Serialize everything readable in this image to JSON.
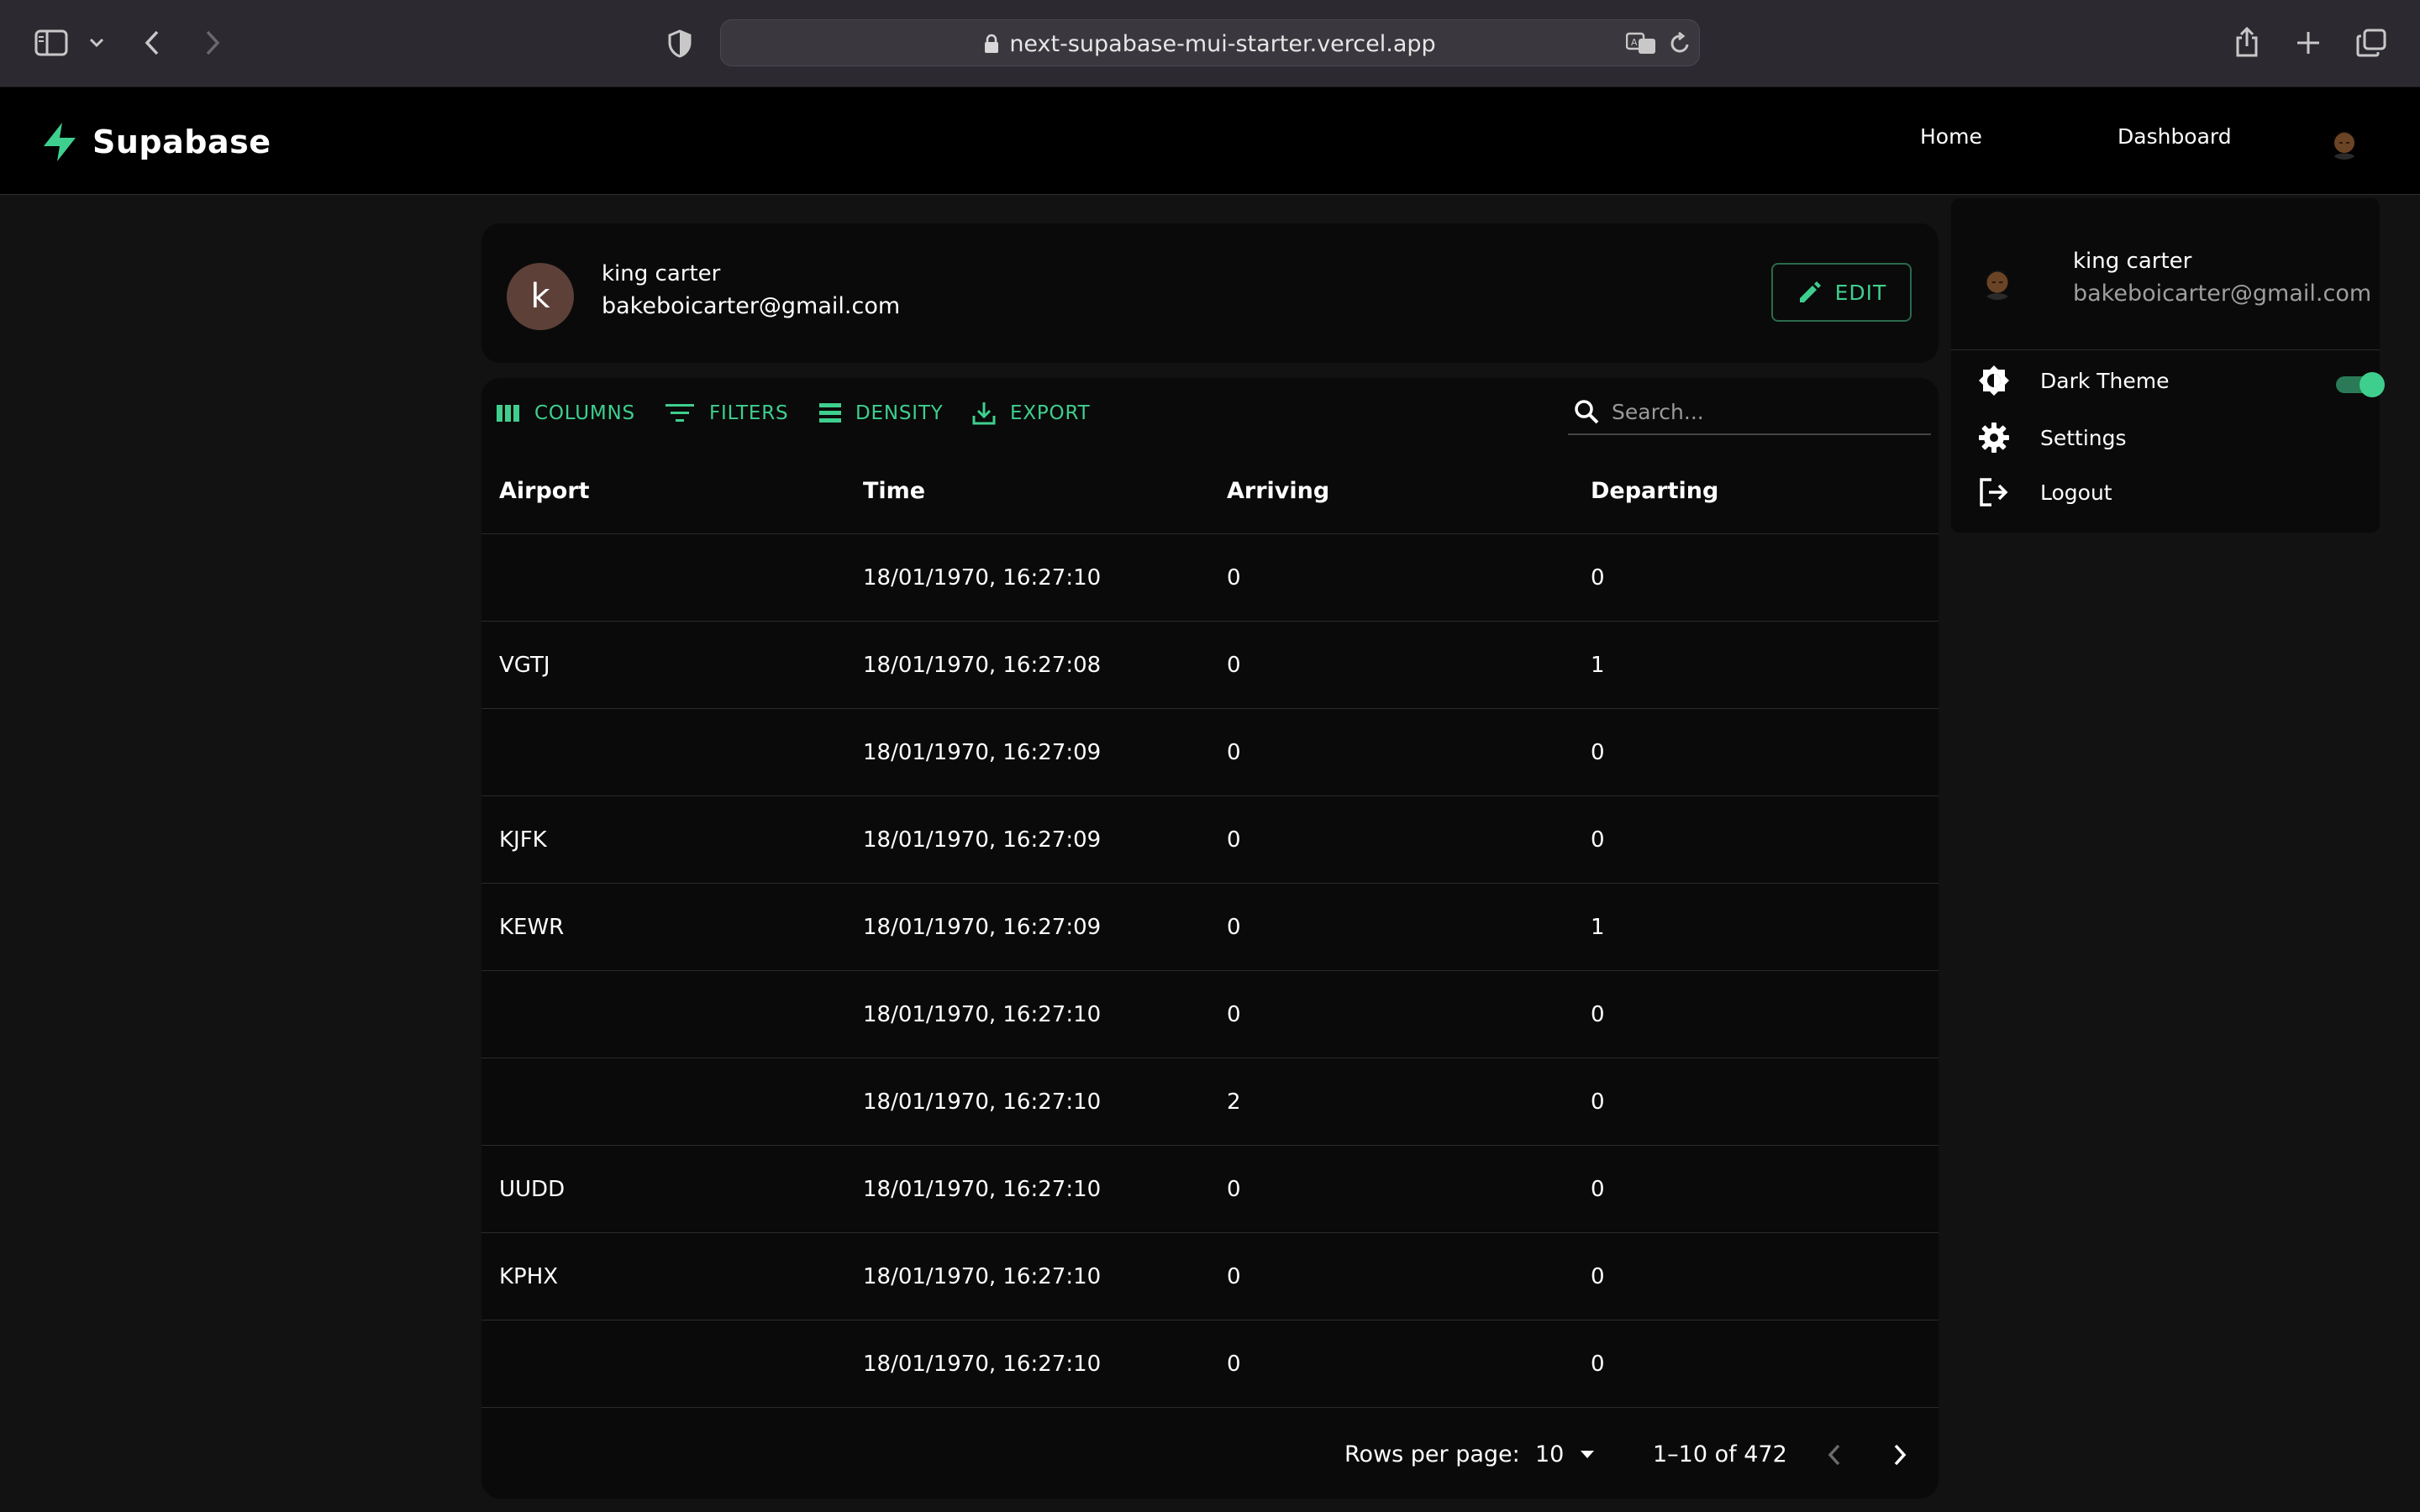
{
  "browser": {
    "url": "next-supabase-mui-starter.vercel.app"
  },
  "app": {
    "brand": "Supabase",
    "nav": {
      "home": "Home",
      "dashboard": "Dashboard"
    },
    "accent_color": "#3ecf8e"
  },
  "profile": {
    "initial": "k",
    "name": "king carter",
    "email": "bakeboicarter@gmail.com",
    "edit_label": "EDIT"
  },
  "toolbar": {
    "columns": "COLUMNS",
    "filters": "FILTERS",
    "density": "DENSITY",
    "export": "EXPORT",
    "search_placeholder": "Search..."
  },
  "table": {
    "headers": [
      "Airport",
      "Time",
      "Arriving",
      "Departing"
    ],
    "rows": [
      [
        "",
        "18/01/1970, 16:27:10",
        "0",
        "0"
      ],
      [
        "VGTJ",
        "18/01/1970, 16:27:08",
        "0",
        "1"
      ],
      [
        "",
        "18/01/1970, 16:27:09",
        "0",
        "0"
      ],
      [
        "KJFK",
        "18/01/1970, 16:27:09",
        "0",
        "0"
      ],
      [
        "KEWR",
        "18/01/1970, 16:27:09",
        "0",
        "1"
      ],
      [
        "",
        "18/01/1970, 16:27:10",
        "0",
        "0"
      ],
      [
        "",
        "18/01/1970, 16:27:10",
        "2",
        "0"
      ],
      [
        "UUDD",
        "18/01/1970, 16:27:10",
        "0",
        "0"
      ],
      [
        "KPHX",
        "18/01/1970, 16:27:10",
        "0",
        "0"
      ],
      [
        "",
        "18/01/1970, 16:27:10",
        "0",
        "0"
      ]
    ]
  },
  "pagination": {
    "rows_per_page_label": "Rows per page:",
    "rows_per_page": "10",
    "range": "1–10 of 472"
  },
  "menu": {
    "name": "king carter",
    "email": "bakeboicarter@gmail.com",
    "dark_theme": "Dark Theme",
    "dark_theme_on": true,
    "settings": "Settings",
    "logout": "Logout"
  }
}
